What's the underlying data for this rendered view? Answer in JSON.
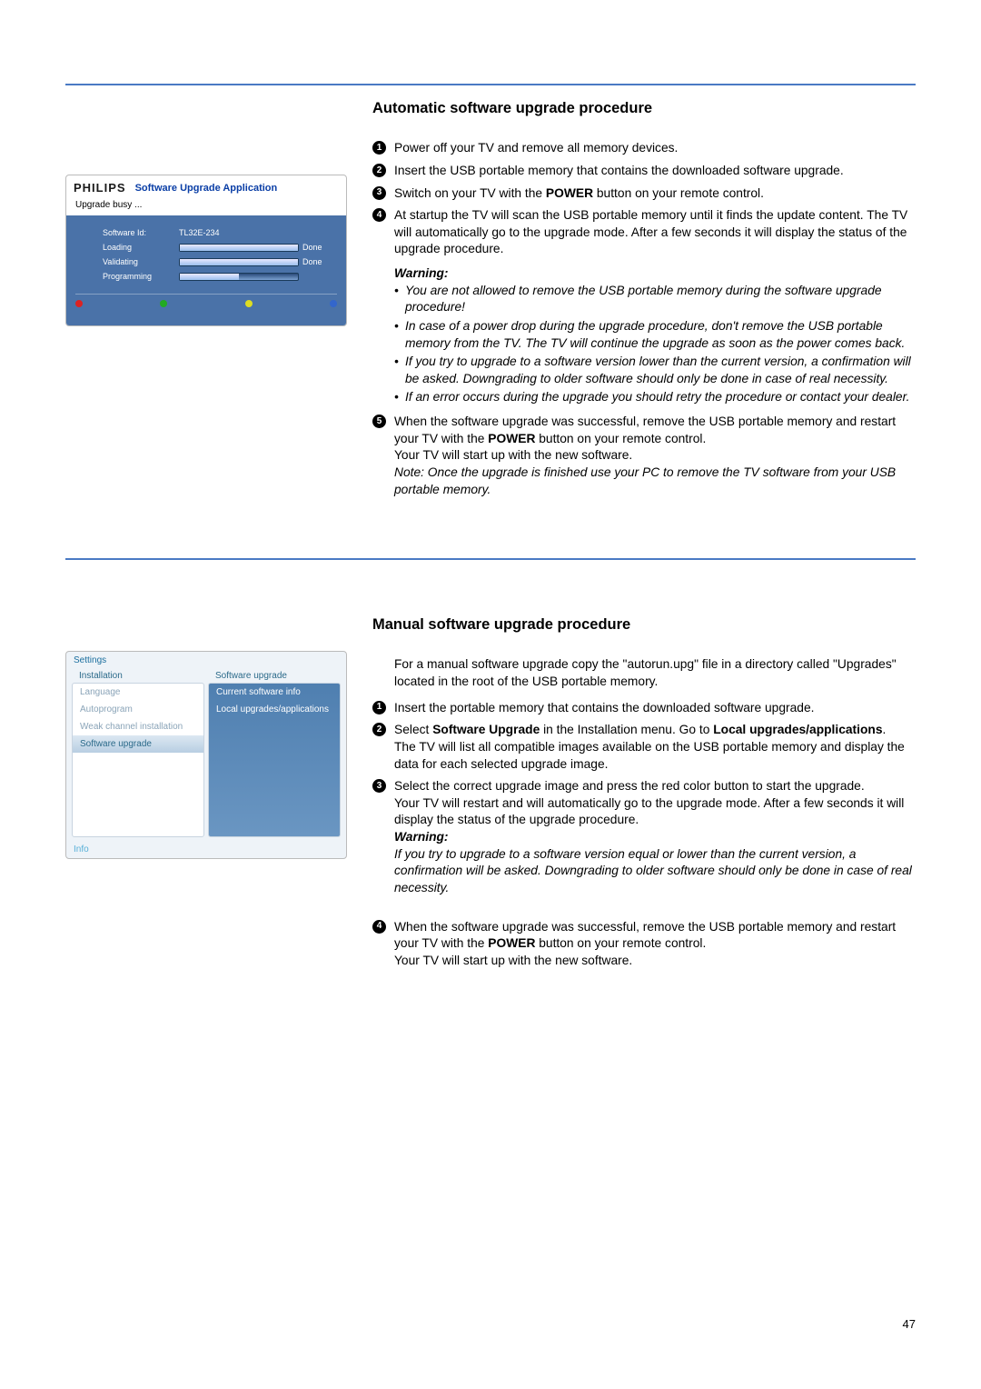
{
  "page_number": "47",
  "section1": {
    "title": "Automatic software upgrade procedure",
    "steps": [
      "Power off your TV and remove all memory devices.",
      "Insert the USB portable memory that contains the downloaded software upgrade.",
      "Switch on your TV with the POWER button on your remote control.",
      "At startup the TV will scan the USB portable memory until it finds the update content. The TV will automatically go to the upgrade mode. After a few seconds it will display the status of the upgrade procedure.",
      "When the software upgrade was successful, remove the USB portable memory and restart your TV with the POWER button on your remote control."
    ],
    "step5_extra": "Your TV will start up with the new software.",
    "step5_note": "Note: Once the upgrade is finished use your PC to remove the TV software from your USB portable memory.",
    "step3_bold": "POWER",
    "step5_bold": "POWER",
    "warning_title": "Warning:",
    "warnings": [
      "You are not allowed to remove the USB portable memory during the software upgrade procedure!",
      "In case of a power drop during the upgrade procedure, don't remove the USB portable memory from the TV. The TV will continue the upgrade as soon as the power comes back.",
      "If you try to upgrade to a software version lower than the current version, a confirmation will be asked. Downgrading to older software should only be done in case of real necessity.",
      "If an error occurs during the upgrade you should retry the procedure or contact your dealer."
    ]
  },
  "upgrade_app": {
    "brand": "PHILIPS",
    "title": "Software Upgrade Application",
    "busy": "Upgrade busy ...",
    "software_id_label": "Software Id:",
    "software_id_value": "TL32E-234",
    "loading": "Loading",
    "validating": "Validating",
    "programming": "Programming",
    "done": "Done"
  },
  "section2": {
    "title": "Manual software upgrade procedure",
    "intro": "For a manual software upgrade copy the \"autorun.upg\" file in a directory called \"Upgrades\" located in the root of the USB portable memory.",
    "steps": {
      "s1": "Insert the portable memory that contains the downloaded software upgrade.",
      "s2a": "Select ",
      "s2_bold1": "Software Upgrade",
      "s2b": " in the Installation menu. Go to ",
      "s2_bold2": "Local upgrades/applications",
      "s2c": ".",
      "s2_body": "The TV will list all compatible images available on the USB portable memory and display the data for each selected upgrade image.",
      "s3": "Select the correct upgrade image and press the red color button to start the upgrade.",
      "s3_body": "Your TV will restart and will automatically go to the upgrade mode. After a few seconds it will display the status of the upgrade procedure.",
      "s4a": "When the software upgrade was successful, remove the USB portable memory and restart your TV with the ",
      "s4_bold": "POWER",
      "s4b": " button on your remote control.",
      "s4_body": "Your TV will start up with the new software."
    },
    "warning_title": "Warning:",
    "warning_body": "If you try to upgrade to a software version equal or lower than the current version, a confirmation will be asked. Downgrading to older software should only be done in case of real necessity."
  },
  "settings_app": {
    "title": "Settings",
    "left_header": "Installation",
    "left_items": [
      "Language",
      "Autoprogram",
      "Weak channel installation",
      "Software upgrade"
    ],
    "right_header": "Software upgrade",
    "right_items": [
      "Current software info",
      "Local upgrades/applications"
    ],
    "info": "Info"
  }
}
